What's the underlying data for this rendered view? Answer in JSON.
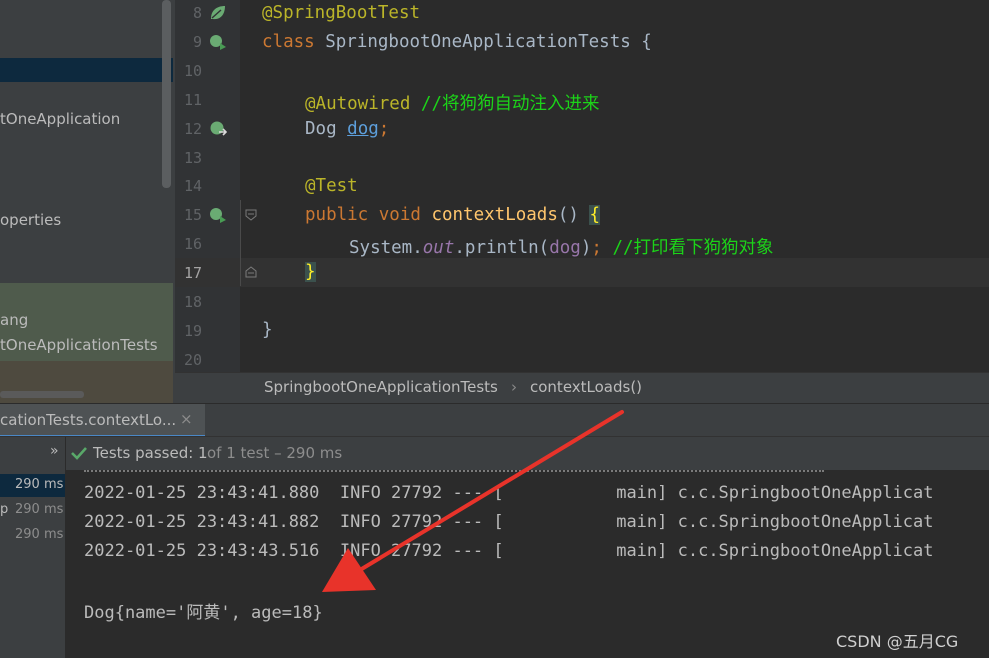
{
  "sidebar": {
    "items": [
      {
        "label": "tOneApplication"
      },
      {
        "label": "operties"
      },
      {
        "label": "ang"
      },
      {
        "label": "tOneApplicationTests"
      }
    ]
  },
  "editor": {
    "lines": [
      {
        "num": "8"
      },
      {
        "num": "9"
      },
      {
        "num": "10"
      },
      {
        "num": "11"
      },
      {
        "num": "12"
      },
      {
        "num": "13"
      },
      {
        "num": "14"
      },
      {
        "num": "15"
      },
      {
        "num": "16"
      },
      {
        "num": "17"
      },
      {
        "num": "18"
      },
      {
        "num": "19"
      },
      {
        "num": "20"
      }
    ],
    "code": {
      "l8_ann": "@SpringBootTest",
      "l9_kw": "class ",
      "l9_rest": "SpringbootOneApplicationTests {",
      "l11_ann": "@Autowired ",
      "l11_cmt": "//将狗狗自动注入进来",
      "l12_type": "Dog ",
      "l12_field": "dog",
      "l12_semi": ";",
      "l14_ann": "@Test",
      "l15_kw": "public void ",
      "l15_method": "contextLoads",
      "l15_rest": "() ",
      "l15_brace": "{",
      "l16_a": "System.",
      "l16_out": "out",
      "l16_b": ".println(",
      "l16_dog": "dog",
      "l16_c": ")",
      "l16_semi": "; ",
      "l16_cmt": "//打印看下狗狗对象",
      "l17_brace": "}",
      "l19_brace": "}"
    }
  },
  "breadcrumb": {
    "class_name": "SpringbootOneApplicationTests",
    "separator": "›",
    "method_name": "contextLoads()"
  },
  "run_panel": {
    "tab_label": "cationTests.contextLo...",
    "close_glyph": "×",
    "chevron": "»",
    "tests_passed": "Tests passed: 1",
    "tests_detail": "of 1 test – 290 ms",
    "tree": [
      {
        "prefix": "",
        "ms": "290 ms"
      },
      {
        "prefix": "p",
        "ms": "290 ms"
      },
      {
        "prefix": "",
        "ms": "290 ms"
      }
    ],
    "console": {
      "log1": "2022-01-25 23:43:41.880  INFO 27792 --- [           main] c.c.SpringbootOneApplicat",
      "log2": "2022-01-25 23:43:41.882  INFO 27792 --- [           main] c.c.SpringbootOneApplicat",
      "log3": "2022-01-25 23:43:43.516  INFO 27792 --- [           main] c.c.SpringbootOneApplicat",
      "output": "Dog{name='阿黄', age=18}"
    }
  },
  "watermark": "CSDN @五月CG",
  "colors": {
    "annotation": "#bbb529",
    "keyword": "#cc7832",
    "comment": "#1cd319",
    "method": "#ffc66d",
    "arrow": "#e8332a",
    "check": "#59a869"
  },
  "icons": [
    "spring-bean-icon",
    "run-test-icon",
    "check-icon",
    "fold-icon",
    "close-icon"
  ]
}
